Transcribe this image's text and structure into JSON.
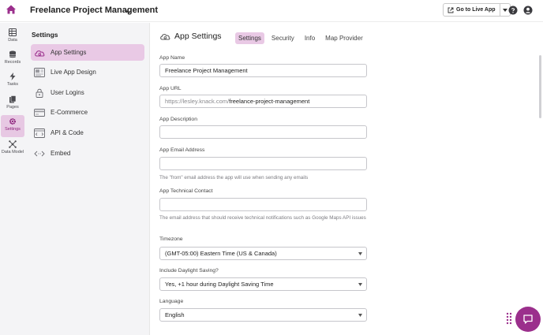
{
  "topbar": {
    "app_title": "Freelance Project Management",
    "live_button": "Go to Live App"
  },
  "rail": {
    "items": [
      {
        "label": "Data",
        "icon": "table-icon"
      },
      {
        "label": "Records",
        "icon": "database-icon"
      },
      {
        "label": "Tasks",
        "icon": "bolt-icon"
      },
      {
        "label": "Pages",
        "icon": "pages-icon"
      },
      {
        "label": "Settings",
        "icon": "gear-icon",
        "active": true
      },
      {
        "label": "Data Model",
        "icon": "data-model-icon"
      }
    ]
  },
  "panel": {
    "title": "Settings",
    "items": [
      {
        "label": "App Settings",
        "icon": "cloud-gear-icon",
        "active": true
      },
      {
        "label": "Live App Design",
        "icon": "design-icon"
      },
      {
        "label": "User Logins",
        "icon": "lock-icon"
      },
      {
        "label": "E-Commerce",
        "icon": "credit-card-icon"
      },
      {
        "label": "API & Code",
        "icon": "api-icon"
      },
      {
        "label": "Embed",
        "icon": "embed-icon"
      }
    ]
  },
  "main": {
    "title": "App Settings",
    "tabs": [
      {
        "label": "Settings",
        "active": true
      },
      {
        "label": "Security"
      },
      {
        "label": "Info"
      },
      {
        "label": "Map Provider"
      }
    ],
    "fields": {
      "app_name": {
        "label": "App Name",
        "value": "Freelance Project Management"
      },
      "app_url": {
        "label": "App URL",
        "prefix": "https://lesley.knack.com/",
        "value": "freelance-project-management"
      },
      "app_description": {
        "label": "App Description",
        "value": ""
      },
      "app_email": {
        "label": "App Email Address",
        "value": "",
        "help": "The \"from\" email address the app will use when sending any emails"
      },
      "tech_contact": {
        "label": "App Technical Contact",
        "value": "",
        "help": "The email address that should receive technical notifications such as Google Maps API issues"
      },
      "timezone": {
        "label": "Timezone",
        "value": "(GMT-05:00) Eastern Time (US & Canada)"
      },
      "daylight": {
        "label": "Include Daylight Saving?",
        "value": "Yes, +1 hour during Daylight Saving Time"
      },
      "language": {
        "label": "Language",
        "value": "English"
      }
    }
  },
  "colors": {
    "accent": "#9b2f8c",
    "active_bg": "#e9c9e5",
    "rail_bg": "#f4f4f6"
  }
}
